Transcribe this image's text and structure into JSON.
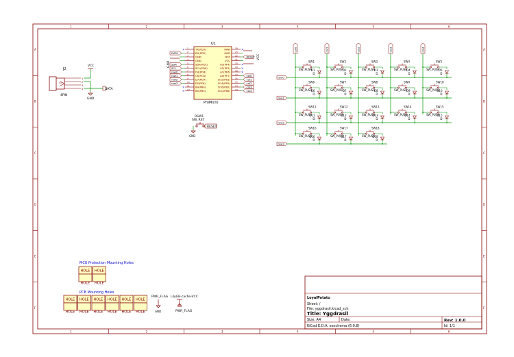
{
  "colors": {
    "frame": "#840000",
    "wire": "#009600",
    "component": "#840000",
    "fill": "#ffffc2",
    "label": "#0000b4",
    "pin": "#840000",
    "text": "#000000",
    "section": "#0000c8",
    "title_text": "#000000"
  },
  "border": {
    "columns": [
      "1",
      "2",
      "3",
      "4",
      "5",
      "6"
    ],
    "rows": [
      "A",
      "B",
      "C",
      "D",
      "E",
      "F"
    ]
  },
  "connector": {
    "ref": "J2",
    "value": "4PIN",
    "pins": [
      "1",
      "2",
      "3",
      "4"
    ],
    "vcc": "VCC",
    "gnd": "GND",
    "data_label": "DATA"
  },
  "mcu": {
    "ref": "U1",
    "value": "ProMicro",
    "left_pin_names": [
      "TX(PD3)",
      "RX(PD2)",
      "GND",
      "GND",
      "SDA(PD1)",
      "SCL(PD0)",
      "D4(PD4)",
      "C6(PC6)",
      "D7(PD7)",
      "E6(PE6)",
      "B4(PB4)",
      "B5(PB5)"
    ],
    "left_pin_numbers": [
      "1",
      "2",
      "3",
      "4",
      "5",
      "6",
      "7",
      "8",
      "9",
      "10",
      "11",
      "12"
    ],
    "right_pin_names": [
      "RAW",
      "GND",
      "RST",
      "VCC",
      "A3(PF4)",
      "A2(PF5)",
      "A1(PF6)",
      "A0(PF7)",
      "D15(PB1)",
      "D14(PB3)",
      "D16(PB2)",
      "D10(PB6)"
    ],
    "right_pin_numbers": [
      "24",
      "23",
      "22",
      "21",
      "20",
      "19",
      "18",
      "17",
      "16",
      "15",
      "14",
      "13"
    ],
    "left_labels": [
      "",
      "DATA",
      "",
      "",
      "SDA",
      "SCL",
      "row0",
      "row1",
      "row2",
      "row3",
      "",
      ""
    ],
    "right_labels": [
      "",
      "",
      "RESET",
      "",
      "",
      "",
      "",
      "col0",
      "col1",
      "col2",
      "col3",
      "col4"
    ],
    "gnd": "GND",
    "vcc": "VCC"
  },
  "reset_switch": {
    "ref": "RSW1",
    "value": "SW_RST",
    "gnd": "GND",
    "label": "RESET"
  },
  "matrix": {
    "columns": [
      "col0",
      "col1",
      "col2",
      "col3",
      "col4"
    ],
    "rows": [
      "row0",
      "row1",
      "row2",
      "row3"
    ],
    "switch_value": "SW_PUSH",
    "diode_value": "D",
    "cells": [
      [
        {
          "sw": "SW1",
          "d": "D1"
        },
        {
          "sw": "SW2",
          "d": "D2"
        },
        {
          "sw": "SW3",
          "d": "D3"
        },
        {
          "sw": "SW4",
          "d": "D4"
        },
        {
          "sw": "SW5",
          "d": "D5"
        }
      ],
      [
        {
          "sw": "SW6",
          "d": "D6"
        },
        {
          "sw": "SW7",
          "d": "D7"
        },
        {
          "sw": "SW8",
          "d": "D8"
        },
        {
          "sw": "SW9",
          "d": "D9"
        },
        {
          "sw": "SW10",
          "d": "D10"
        }
      ],
      [
        {
          "sw": "SW11",
          "d": "D11"
        },
        {
          "sw": "SW12",
          "d": "D12"
        },
        {
          "sw": "SW13",
          "d": "D13"
        },
        {
          "sw": "SW14",
          "d": "D14"
        },
        {
          "sw": "SW15",
          "d": "D15"
        }
      ],
      [
        {
          "sw": "SW16",
          "d": "D16"
        },
        {
          "sw": "SW17",
          "d": "D17"
        },
        {
          "sw": "SW18",
          "d": "D18"
        }
      ]
    ]
  },
  "mcu_holes": {
    "title": "MCU Protection Mounting Holes",
    "items": [
      {
        "ref": "TH1",
        "value": "HOLE"
      },
      {
        "ref": "TH2",
        "value": "HOLE"
      }
    ]
  },
  "pcb_holes": {
    "title": "PCB Mounting Holes",
    "items": [
      {
        "ref": "TH8",
        "value": "HOLE"
      },
      {
        "ref": "TH3",
        "value": "HOLE"
      },
      {
        "ref": "TH4",
        "value": "HOLE"
      },
      {
        "ref": "TH5",
        "value": "HOLE"
      },
      {
        "ref": "TH6",
        "value": "HOLE"
      },
      {
        "ref": "TH7",
        "value": "HOLE"
      }
    ]
  },
  "power_flags": [
    {
      "top": "PWR_FLAG",
      "bottom": "GND"
    },
    {
      "top": "LilyGB-cache-VCC",
      "bottom": "PWR_FLAG"
    }
  ],
  "title_block": {
    "company": "LoyalPotato",
    "sheet": "Sheet: /",
    "file": "File: yggdrasil.kicad_sch",
    "title": "Title: Yggdrasil",
    "size": "Size: A4",
    "date": "Date:",
    "tool": "KiCad E.D.A.  eeschema (6.0.8)",
    "rev": "Rev: 1.0.0",
    "id": "Id: 1/1"
  }
}
